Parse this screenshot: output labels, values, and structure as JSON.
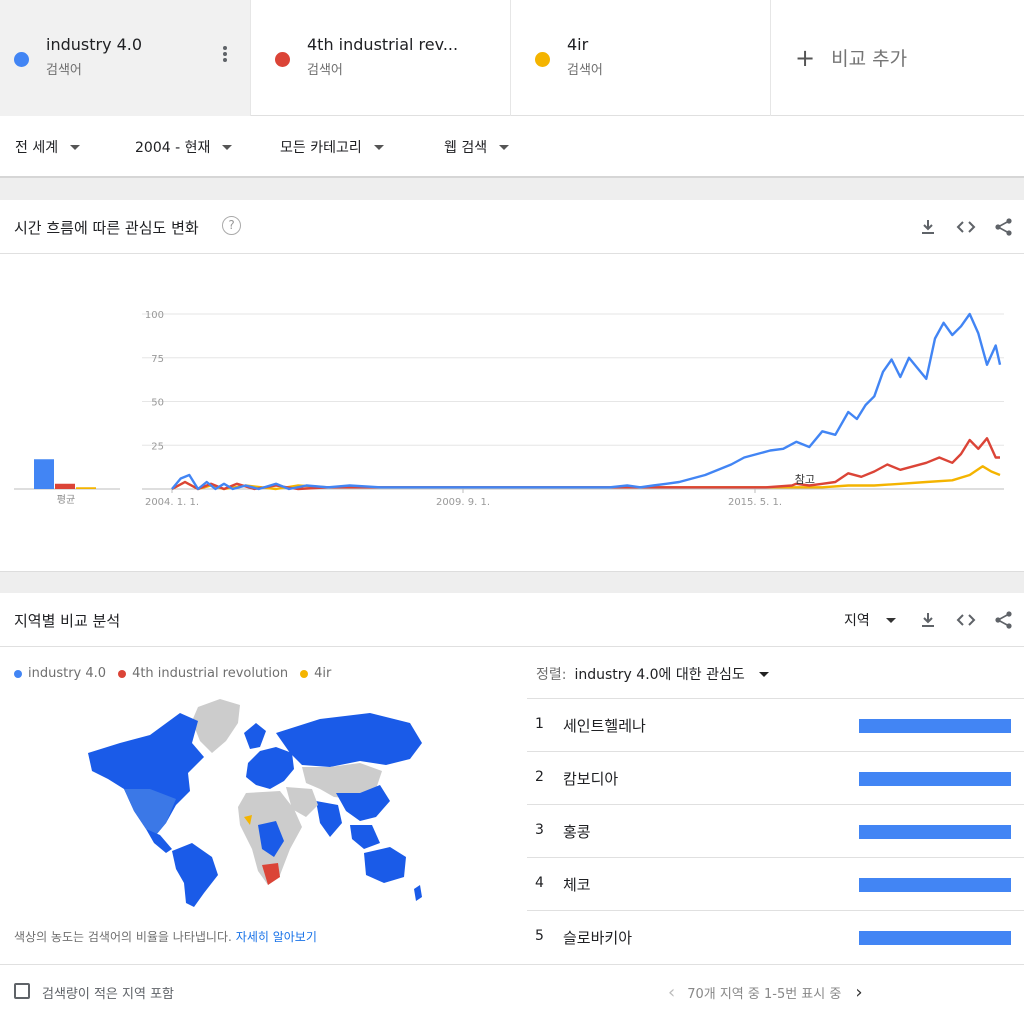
{
  "terms": [
    {
      "name": "industry 4.0",
      "sub": "검색어",
      "color": "#4285f4"
    },
    {
      "name": "4th industrial rev...",
      "sub": "검색어",
      "color": "#db4437"
    },
    {
      "name": "4ir",
      "sub": "검색어",
      "color": "#f4b400"
    }
  ],
  "add_compare": "비교 추가",
  "filters": {
    "region": "전 세계",
    "period": "2004 - 현재",
    "category": "모든 카테고리",
    "search_type": "웹 검색"
  },
  "interest_over_time": {
    "title": "시간 흐름에 따른 관심도 변화",
    "help_icon": "help-circle-icon",
    "average_label": "평균",
    "note_label": "참고"
  },
  "chart_data": {
    "type": "line",
    "yticks": [
      25,
      50,
      75,
      100
    ],
    "ylim": [
      0,
      100
    ],
    "xticks": [
      "2004. 1. 1.",
      "2009. 9. 1.",
      "2015. 5. 1."
    ],
    "xlim": [
      "2004-01",
      "2019-12"
    ],
    "averages": [
      {
        "name": "industry 4.0",
        "value": 17,
        "color": "#4285f4"
      },
      {
        "name": "4th industrial revolution",
        "value": 3,
        "color": "#db4437"
      },
      {
        "name": "4ir",
        "value": 1,
        "color": "#f4b400"
      }
    ],
    "series": [
      {
        "name": "industry 4.0",
        "color": "#4285f4",
        "points": [
          [
            "2004-01",
            0
          ],
          [
            "2004-03",
            6
          ],
          [
            "2004-05",
            8
          ],
          [
            "2004-07",
            0
          ],
          [
            "2004-09",
            4
          ],
          [
            "2004-11",
            0
          ],
          [
            "2005-01",
            3
          ],
          [
            "2005-03",
            0
          ],
          [
            "2005-06",
            2
          ],
          [
            "2005-09",
            0
          ],
          [
            "2006-01",
            3
          ],
          [
            "2006-04",
            0
          ],
          [
            "2006-08",
            2
          ],
          [
            "2007-01",
            1
          ],
          [
            "2007-06",
            2
          ],
          [
            "2008-01",
            1
          ],
          [
            "2008-06",
            1
          ],
          [
            "2009-01",
            1
          ],
          [
            "2009-06",
            1
          ],
          [
            "2010-01",
            1
          ],
          [
            "2010-06",
            1
          ],
          [
            "2011-01",
            1
          ],
          [
            "2011-06",
            1
          ],
          [
            "2012-01",
            1
          ],
          [
            "2012-06",
            1
          ],
          [
            "2012-10",
            2
          ],
          [
            "2013-01",
            1
          ],
          [
            "2013-04",
            2
          ],
          [
            "2013-07",
            3
          ],
          [
            "2013-10",
            4
          ],
          [
            "2014-01",
            6
          ],
          [
            "2014-04",
            8
          ],
          [
            "2014-07",
            11
          ],
          [
            "2014-10",
            14
          ],
          [
            "2015-01",
            18
          ],
          [
            "2015-04",
            20
          ],
          [
            "2015-07",
            22
          ],
          [
            "2015-10",
            23
          ],
          [
            "2016-01",
            27
          ],
          [
            "2016-04",
            24
          ],
          [
            "2016-07",
            33
          ],
          [
            "2016-10",
            31
          ],
          [
            "2017-01",
            44
          ],
          [
            "2017-03",
            40
          ],
          [
            "2017-05",
            48
          ],
          [
            "2017-07",
            53
          ],
          [
            "2017-09",
            67
          ],
          [
            "2017-11",
            74
          ],
          [
            "2018-01",
            64
          ],
          [
            "2018-03",
            75
          ],
          [
            "2018-05",
            69
          ],
          [
            "2018-07",
            63
          ],
          [
            "2018-09",
            86
          ],
          [
            "2018-11",
            95
          ],
          [
            "2019-01",
            88
          ],
          [
            "2019-03",
            93
          ],
          [
            "2019-05",
            100
          ],
          [
            "2019-07",
            89
          ],
          [
            "2019-09",
            71
          ],
          [
            "2019-11",
            82
          ],
          [
            "2019-12",
            71
          ]
        ]
      },
      {
        "name": "4th industrial revolution",
        "color": "#db4437",
        "points": [
          [
            "2004-01",
            0
          ],
          [
            "2004-04",
            4
          ],
          [
            "2004-07",
            0
          ],
          [
            "2004-10",
            3
          ],
          [
            "2005-01",
            0
          ],
          [
            "2005-04",
            3
          ],
          [
            "2005-08",
            0
          ],
          [
            "2006-01",
            2
          ],
          [
            "2006-06",
            0
          ],
          [
            "2007-01",
            1
          ],
          [
            "2008-01",
            1
          ],
          [
            "2009-01",
            1
          ],
          [
            "2010-01",
            1
          ],
          [
            "2011-01",
            1
          ],
          [
            "2012-01",
            1
          ],
          [
            "2013-01",
            1
          ],
          [
            "2014-01",
            1
          ],
          [
            "2015-01",
            1
          ],
          [
            "2015-06",
            1
          ],
          [
            "2015-12",
            2
          ],
          [
            "2016-01",
            3
          ],
          [
            "2016-04",
            2
          ],
          [
            "2016-07",
            3
          ],
          [
            "2016-10",
            4
          ],
          [
            "2017-01",
            9
          ],
          [
            "2017-04",
            7
          ],
          [
            "2017-07",
            10
          ],
          [
            "2017-10",
            14
          ],
          [
            "2018-01",
            11
          ],
          [
            "2018-04",
            13
          ],
          [
            "2018-07",
            15
          ],
          [
            "2018-10",
            18
          ],
          [
            "2019-01",
            15
          ],
          [
            "2019-03",
            20
          ],
          [
            "2019-05",
            28
          ],
          [
            "2019-07",
            23
          ],
          [
            "2019-09",
            29
          ],
          [
            "2019-11",
            18
          ],
          [
            "2019-12",
            18
          ]
        ]
      },
      {
        "name": "4ir",
        "color": "#f4b400",
        "points": [
          [
            "2004-01",
            0
          ],
          [
            "2004-04",
            4
          ],
          [
            "2004-07",
            0
          ],
          [
            "2004-10",
            2
          ],
          [
            "2005-01",
            0
          ],
          [
            "2005-06",
            2
          ],
          [
            "2006-01",
            0
          ],
          [
            "2006-06",
            2
          ],
          [
            "2007-01",
            1
          ],
          [
            "2008-01",
            1
          ],
          [
            "2009-01",
            1
          ],
          [
            "2010-01",
            1
          ],
          [
            "2011-01",
            1
          ],
          [
            "2012-01",
            1
          ],
          [
            "2013-01",
            1
          ],
          [
            "2014-01",
            1
          ],
          [
            "2015-01",
            1
          ],
          [
            "2016-01",
            1
          ],
          [
            "2016-07",
            1
          ],
          [
            "2017-01",
            2
          ],
          [
            "2017-07",
            2
          ],
          [
            "2018-01",
            3
          ],
          [
            "2018-07",
            4
          ],
          [
            "2019-01",
            5
          ],
          [
            "2019-05",
            8
          ],
          [
            "2019-08",
            13
          ],
          [
            "2019-10",
            10
          ],
          [
            "2019-12",
            8
          ]
        ]
      }
    ]
  },
  "region": {
    "title": "지역별 비교 분석",
    "region_dropdown": "지역",
    "legend": [
      "industry 4.0",
      "4th industrial revolution",
      "4ir"
    ],
    "sort_label": "정렬:",
    "sort_value": "industry 4.0에 대한 관심도",
    "rankings": [
      {
        "rank": "1",
        "name": "세인트헬레나",
        "value": 100
      },
      {
        "rank": "2",
        "name": "캄보디아",
        "value": 100
      },
      {
        "rank": "3",
        "name": "홍콩",
        "value": 100
      },
      {
        "rank": "4",
        "name": "체코",
        "value": 100
      },
      {
        "rank": "5",
        "name": "슬로바키아",
        "value": 100
      }
    ],
    "note": "색상의 농도는 검색어의 비율을 나타냅니다.",
    "note_link": "자세히 알아보기",
    "low_volume_label": "검색량이 적은 지역 포함",
    "pagination": "70개 지역 중 1-5번 표시 중"
  }
}
